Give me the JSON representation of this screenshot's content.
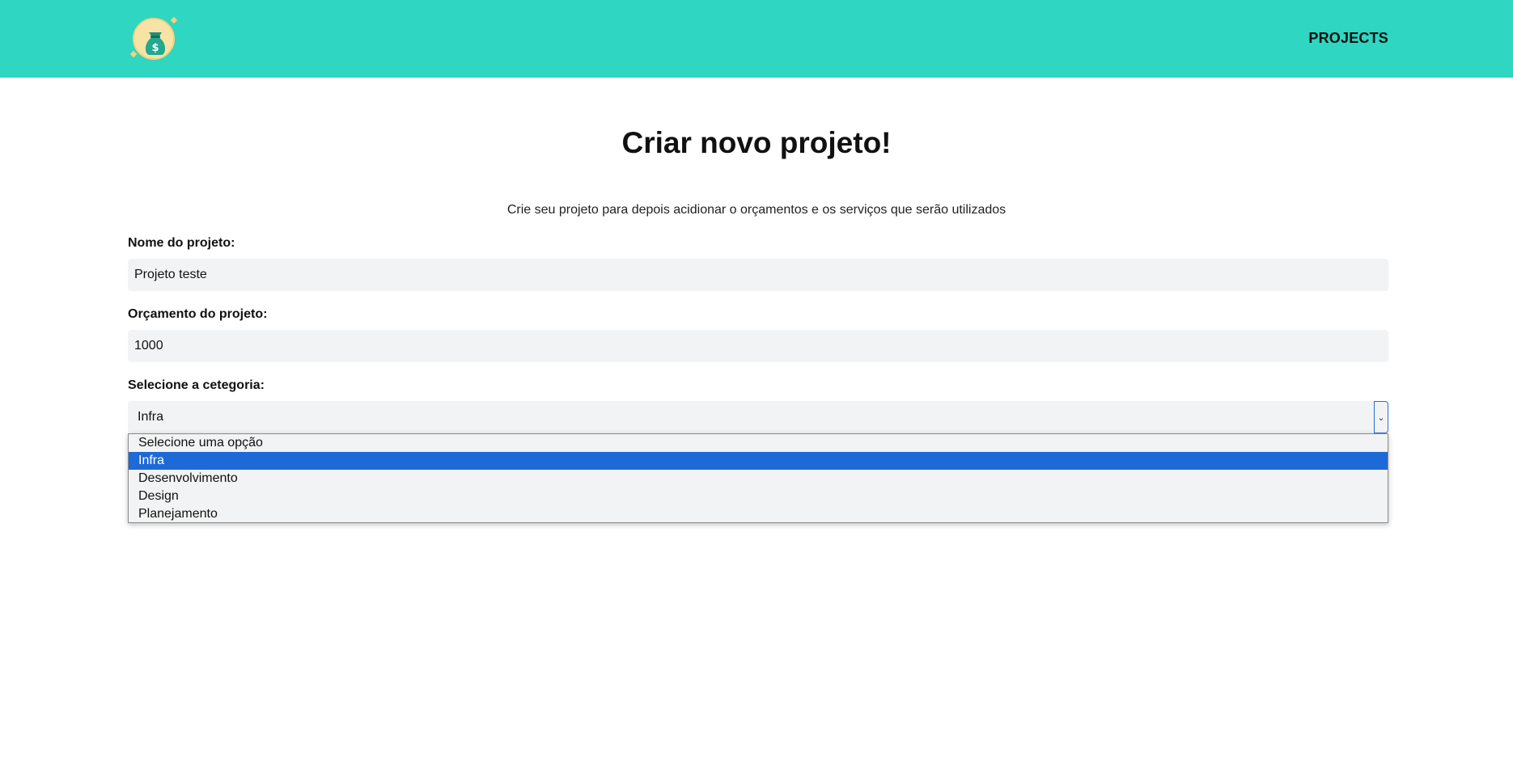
{
  "header": {
    "logo_icon": "money-bag-icon",
    "nav_projects": "PROJECTS",
    "bg_color": "#2fd6c1"
  },
  "main": {
    "title": "Criar novo projeto!",
    "subtitle": "Crie seu projeto para depois acidionar o orçamentos e os serviços que serão utilizados"
  },
  "form": {
    "name_label": "Nome do projeto:",
    "name_value": "Projeto teste",
    "budget_label": "Orçamento do projeto:",
    "budget_value": "1000",
    "category_label": "Selecione a cetegoria:",
    "category_value": "Infra",
    "category_options": [
      "Selecione uma opção",
      "Infra",
      "Desenvolvimento",
      "Design",
      "Planejamento"
    ],
    "selected_option_index": 1,
    "selected_option_color": "#1e69d8"
  }
}
